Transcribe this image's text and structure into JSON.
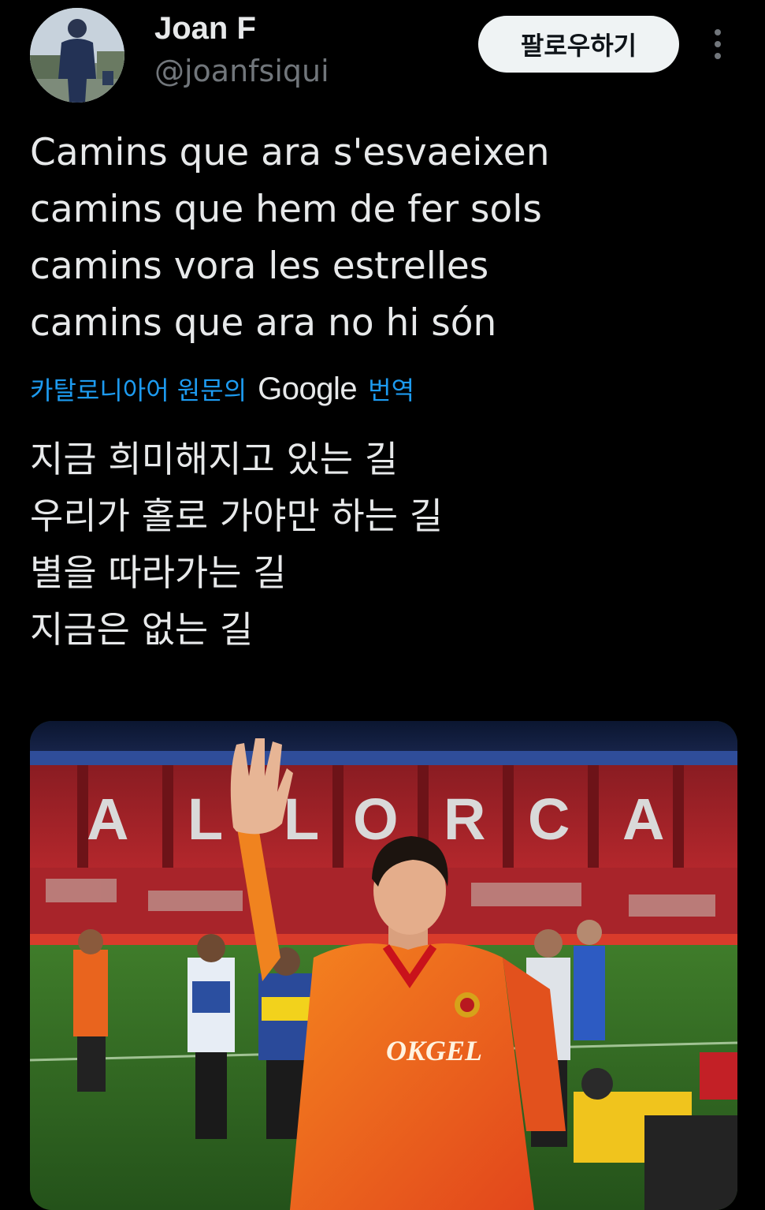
{
  "user": {
    "display_name": "Joan F",
    "handle": "@joanfsiqui"
  },
  "actions": {
    "follow_label": "팔로우하기",
    "more_icon": "more-vertical-icon"
  },
  "tweet": {
    "lines": [
      "Camins que ara s'esvaeixen",
      "camins que hem de fer sols",
      "camins vora les estrelles",
      "camins que ara no hi són"
    ]
  },
  "translation": {
    "source_label": "카탈로니아어 원문의",
    "provider": "Google",
    "action_label": "번역",
    "lines": [
      "지금 희미해지고 있는 길",
      "우리가 홀로 가야만 하는 길",
      "별을 따라가는 길",
      "지금은 없는 길"
    ]
  },
  "media": {
    "stadium_letters": [
      "A",
      "L",
      "L",
      "O",
      "R",
      "C",
      "A"
    ],
    "jersey_text": "OKGEL"
  },
  "colors": {
    "background": "#000000",
    "text_primary": "#e7e9ea",
    "text_secondary": "#71767b",
    "link": "#1d9bf0",
    "button_bg": "#eff3f4"
  }
}
